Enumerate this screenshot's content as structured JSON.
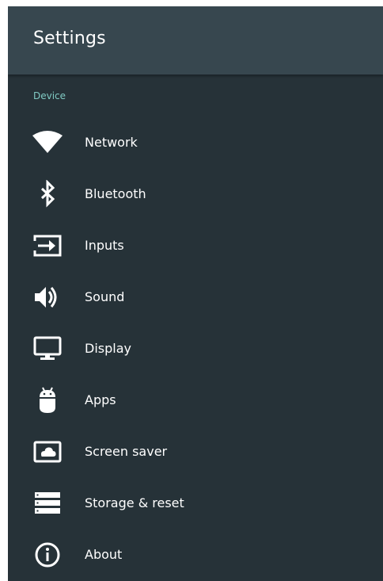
{
  "header": {
    "title": "Settings"
  },
  "section": {
    "label": "Device"
  },
  "items": [
    {
      "label": "Network",
      "icon": "wifi-icon"
    },
    {
      "label": "Bluetooth",
      "icon": "bluetooth-icon"
    },
    {
      "label": "Inputs",
      "icon": "input-icon"
    },
    {
      "label": "Sound",
      "icon": "speaker-icon"
    },
    {
      "label": "Display",
      "icon": "monitor-icon"
    },
    {
      "label": "Apps",
      "icon": "android-icon"
    },
    {
      "label": "Screen saver",
      "icon": "screensaver-icon"
    },
    {
      "label": "Storage & reset",
      "icon": "storage-icon"
    },
    {
      "label": "About",
      "icon": "info-icon"
    }
  ],
  "colors": {
    "background": "#263238",
    "header": "#37474f",
    "section_accent": "#80cbc4",
    "text": "#ffffff"
  }
}
